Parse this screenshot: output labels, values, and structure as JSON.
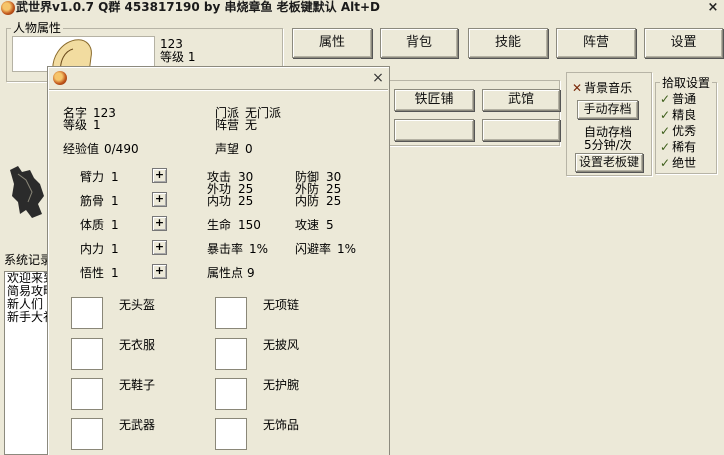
{
  "window": {
    "title": "武世界v1.0.7  Q群 453817190   by 串烧章鱼  老板键默认 Alt+D",
    "close_glyph": "×"
  },
  "character_panel": {
    "label": "人物属性",
    "name": "123",
    "level": "等级 1"
  },
  "main_buttons": [
    "属性",
    "背包",
    "技能",
    "阵营",
    "设置"
  ],
  "town_buttons": [
    "铁匠铺",
    "武馆",
    "",
    ""
  ],
  "music_panel": {
    "bgm_label": "背景音乐",
    "manual_save": "手动存档",
    "auto_save": "自动存档",
    "auto_interval": "5分钟/次",
    "boss_key": "设置老板键"
  },
  "loot_panel": {
    "label": "拾取设置",
    "options": [
      "普通",
      "精良",
      "优秀",
      "稀有",
      "绝世"
    ]
  },
  "system_log": {
    "label": "系统记录",
    "lines": [
      "欢迎来到",
      "简易攻略",
      "新人们",
      "新手大礼"
    ]
  },
  "dialog": {
    "close_glyph": "×",
    "name_label": "名字",
    "name_value": "123",
    "level_label": "等级",
    "level_value": "1",
    "sect_label": "门派",
    "sect_value": "无门派",
    "faction_label": "阵营",
    "faction_value": "无",
    "exp_label": "经验值",
    "exp_value": "0/490",
    "fame_label": "声望",
    "fame_value": "0",
    "base_stats": [
      {
        "label": "臂力",
        "value": "1"
      },
      {
        "label": "筋骨",
        "value": "1"
      },
      {
        "label": "体质",
        "value": "1"
      },
      {
        "label": "内力",
        "value": "1"
      },
      {
        "label": "悟性",
        "value": "1"
      }
    ],
    "plus_glyph": "+",
    "derived": {
      "attack_label": "攻击",
      "attack_value": "30",
      "ext_atk_label": "外功",
      "ext_atk_value": "25",
      "int_atk_label": "内功",
      "int_atk_value": "25",
      "defense_label": "防御",
      "defense_value": "30",
      "ext_def_label": "外防",
      "ext_def_value": "25",
      "int_def_label": "内防",
      "int_def_value": "25",
      "hp_label": "生命",
      "hp_value": "150",
      "speed_label": "攻速",
      "speed_value": "5",
      "crit_label": "暴击率",
      "crit_value": "1%",
      "dodge_label": "闪避率",
      "dodge_value": "1%",
      "points_label": "属性点",
      "points_value": "9"
    },
    "equipment": {
      "left": [
        "无头盔",
        "无衣服",
        "无鞋子",
        "无武器"
      ],
      "right": [
        "无项链",
        "无披风",
        "无护腕",
        "无饰品"
      ]
    }
  }
}
